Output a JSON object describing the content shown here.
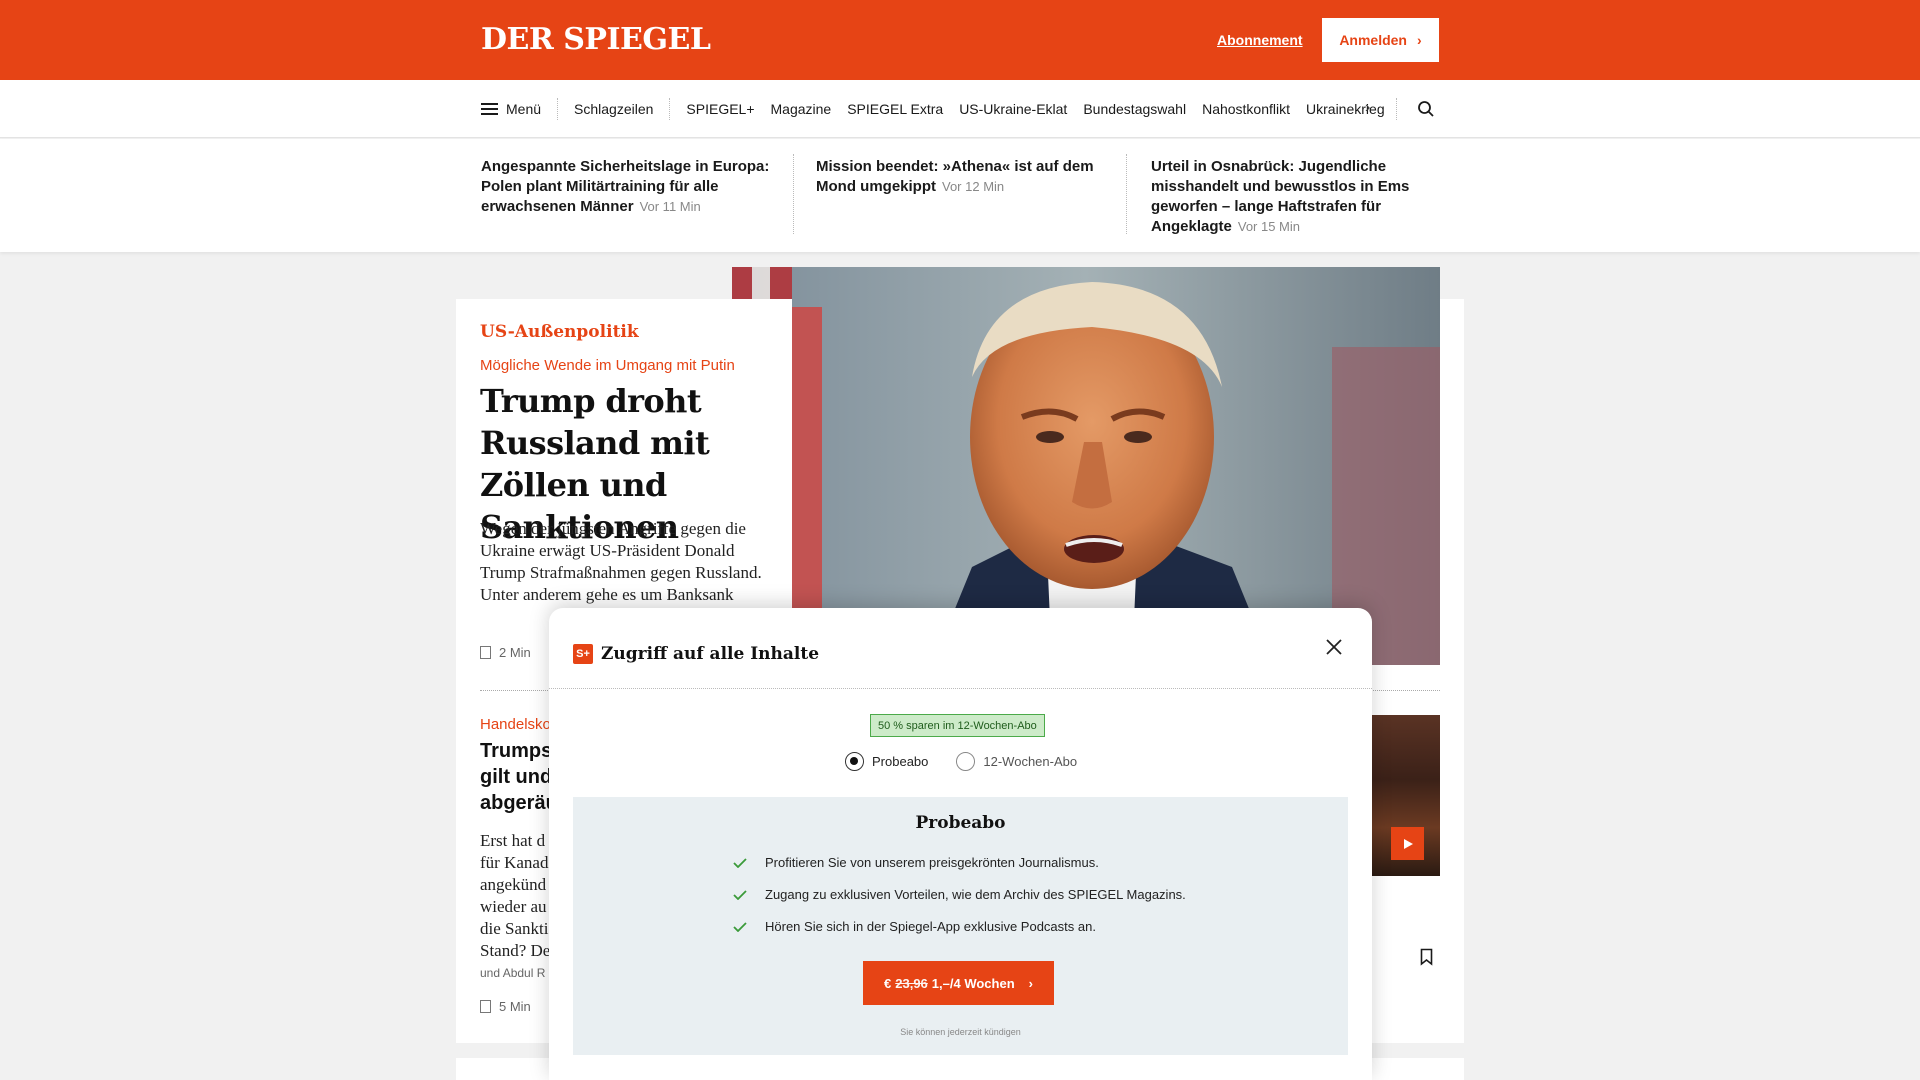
{
  "brand": {
    "logo": "DER SPIEGEL",
    "accent": "#e64415"
  },
  "header": {
    "subscription_link": "Abonnement",
    "login_button": "Anmelden"
  },
  "nav": {
    "menu_label": "Menü",
    "headlines_label": "Schlagzeilen",
    "items": [
      "SPIEGEL+",
      "Magazine",
      "SPIEGEL Extra",
      "US-Ukraine-Eklat",
      "Bundestagswahl",
      "Nahostkonflikt",
      "Ukrainekrieg"
    ],
    "icons": {
      "menu": "hamburger-icon",
      "next": "chevron-right-icon",
      "search": "search-icon"
    }
  },
  "ticker": [
    {
      "title": "Angespannte Sicherheitslage in Europa: Polen plant Militärtraining für alle erwachsenen Männer",
      "ago": "Vor 11 Min"
    },
    {
      "title": "Mission beendet: »Athena« ist auf dem Mond umgekippt",
      "ago": "Vor 12 Min"
    },
    {
      "title": "Urteil in Osnabrück: Jugendliche misshandelt und bewusstlos in Ems geworfen – lange Haftstrafen für Angeklagte",
      "ago": "Vor 15 Min"
    }
  ],
  "lead_article": {
    "kicker": "US-Außenpolitik",
    "subkicker": "Mögliche Wende im Umgang mit Putin",
    "headline": "Trump droht Russland mit Zöllen und Sanktionen",
    "teaser": "Wegen der jüngsten Angriffe gegen die Ukraine erwägt US-Präsident Donald Trump Strafmaßnahmen gegen Russland. Unter anderem gehe es um Banksank",
    "read_time": "2 Min"
  },
  "second_article": {
    "kicker": "Handelsko",
    "headline_lines": [
      "Trumps",
      "gilt und",
      "abgeräu"
    ],
    "teaser_lines": [
      "Erst hat d",
      "für Kanad",
      "angekünd",
      "wieder au",
      "die Sankti",
      "Stand? De"
    ],
    "author": "und Abdul R",
    "read_time": "5 Min"
  },
  "modal": {
    "badge": "S+",
    "title": "Zugriff auf alle Inhalte",
    "save_badge": "50 % sparen im 12-Wochen-Abo",
    "options": [
      "Probeabo",
      "12-Wochen-Abo"
    ],
    "selected_option": "Probeabo",
    "offer_title": "Probeabo",
    "benefits": [
      "Profitieren Sie von unserem preisgekrönten Journalismus.",
      "Zugang zu exklusiven Vorteilen, wie dem Archiv des SPIEGEL Magazins.",
      "Hören Sie sich in der Spiegel-App exklusive Podcasts an."
    ],
    "cta_currency": "€",
    "cta_old_price": "23,96",
    "cta_new_price": "1,–/4 Wochen",
    "cancel_note": "Sie können jederzeit kündigen"
  }
}
